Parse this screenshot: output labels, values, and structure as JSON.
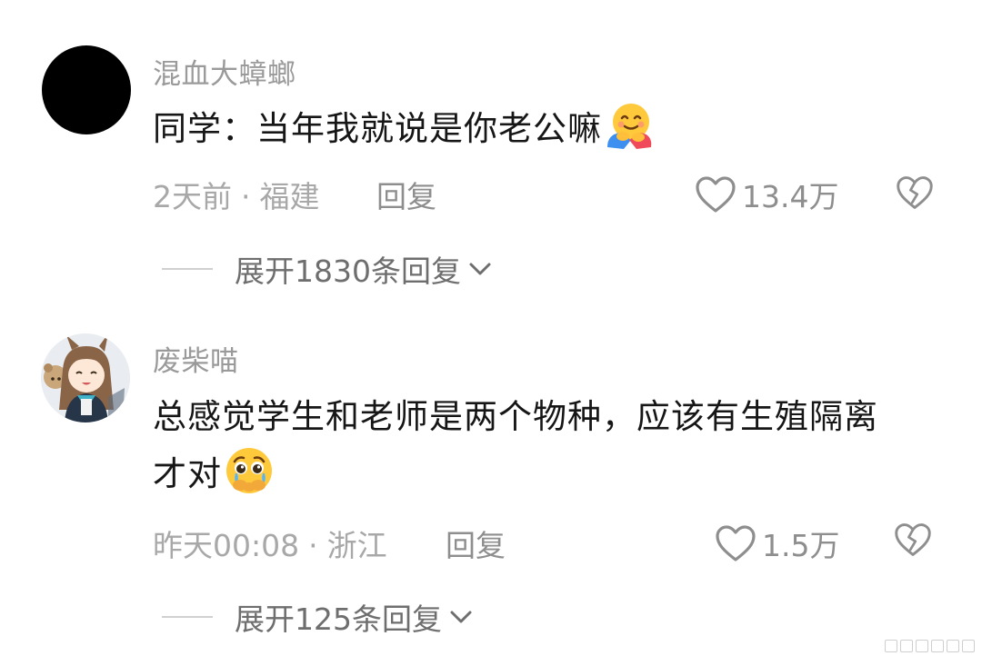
{
  "comments": [
    {
      "username": "混血大蟑螂",
      "text": "同学：当年我就说是你老公嘛",
      "emoji": "hugging-face-emoji",
      "time": "2天前",
      "separator": "·",
      "location": "福建",
      "reply_label": "回复",
      "likes": "13.4万",
      "expand_label": "展开1830条回复",
      "avatar": "black-circle-avatar"
    },
    {
      "username": "废柴喵",
      "text_line1": "总感觉学生和老师是两个物种，应该有生殖隔离",
      "text_line2": "才对",
      "emoji": "crying-pleading-face-emoji",
      "time": "昨天00:08",
      "separator": "·",
      "location": "浙江",
      "reply_label": "回复",
      "likes": "1.5万",
      "expand_label": "展开125条回复",
      "avatar": "anime-girl-avatar"
    }
  ],
  "icons": {
    "like": "heart-outline-icon",
    "dislike": "broken-heart-icon",
    "expand": "chevron-down-icon"
  },
  "colors": {
    "text": "#161616",
    "muted": "#a8a8a8",
    "icon": "#8e8e8e"
  }
}
